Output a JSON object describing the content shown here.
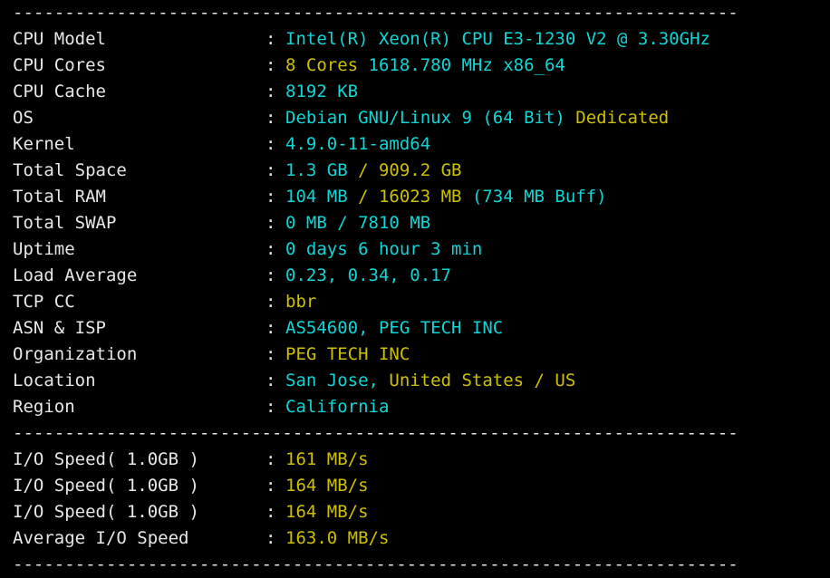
{
  "terminal": {
    "background": "#000000",
    "divider_char": "-",
    "divider_color": "#e6e6e6",
    "colon": ":",
    "colors": {
      "cyan": "#0fd5d5",
      "yellow": "#cdc000",
      "white": "#e8e8e8"
    },
    "divider_top": "----------------------------------------------------------------------",
    "divider_middle": "----------------------------------------------------------------------",
    "divider_bottom": "----------------------------------------------------------------------"
  },
  "system_info": {
    "rows": [
      {
        "label": "CPU Model",
        "segments": [
          {
            "text": "Intel(R) Xeon(R) CPU E3-1230 V2 @ 3.30GHz",
            "color": "cyan"
          }
        ]
      },
      {
        "label": "CPU Cores",
        "segments": [
          {
            "text": "8 Cores",
            "color": "yellow"
          },
          {
            "text": " 1618.780 MHz x86_64",
            "color": "cyan"
          }
        ]
      },
      {
        "label": "CPU Cache",
        "segments": [
          {
            "text": "8192 KB",
            "color": "cyan"
          }
        ]
      },
      {
        "label": "OS",
        "segments": [
          {
            "text": "Debian GNU/Linux 9 (64 Bit) ",
            "color": "cyan"
          },
          {
            "text": "Dedicated",
            "color": "yellow"
          }
        ]
      },
      {
        "label": "Kernel",
        "segments": [
          {
            "text": "4.9.0-11-amd64",
            "color": "cyan"
          }
        ]
      },
      {
        "label": "Total Space",
        "segments": [
          {
            "text": "1.3 GB ",
            "color": "cyan"
          },
          {
            "text": "/ 909.2 GB",
            "color": "yellow"
          }
        ]
      },
      {
        "label": "Total RAM",
        "segments": [
          {
            "text": "104 MB ",
            "color": "cyan"
          },
          {
            "text": "/ 16023 MB",
            "color": "yellow"
          },
          {
            "text": " (734 MB Buff)",
            "color": "cyan"
          }
        ]
      },
      {
        "label": "Total SWAP",
        "segments": [
          {
            "text": "0 MB / 7810 MB",
            "color": "cyan"
          }
        ]
      },
      {
        "label": "Uptime",
        "segments": [
          {
            "text": "0 days 6 hour 3 min",
            "color": "cyan"
          }
        ]
      },
      {
        "label": "Load Average",
        "segments": [
          {
            "text": "0.23, 0.34, 0.17",
            "color": "cyan"
          }
        ]
      },
      {
        "label": "TCP CC",
        "segments": [
          {
            "text": "bbr",
            "color": "yellow"
          }
        ]
      },
      {
        "label": "ASN & ISP",
        "segments": [
          {
            "text": "AS54600, PEG TECH INC",
            "color": "cyan"
          }
        ]
      },
      {
        "label": "Organization",
        "segments": [
          {
            "text": "PEG TECH INC",
            "color": "yellow"
          }
        ]
      },
      {
        "label": "Location",
        "segments": [
          {
            "text": "San Jose, ",
            "color": "cyan"
          },
          {
            "text": "United States / US",
            "color": "yellow"
          }
        ]
      },
      {
        "label": "Region",
        "segments": [
          {
            "text": "California",
            "color": "cyan"
          }
        ]
      }
    ]
  },
  "io_benchmark": {
    "rows": [
      {
        "label": "I/O Speed( 1.0GB )",
        "segments": [
          {
            "text": "161 MB/s",
            "color": "yellow"
          }
        ]
      },
      {
        "label": "I/O Speed( 1.0GB )",
        "segments": [
          {
            "text": "164 MB/s",
            "color": "yellow"
          }
        ]
      },
      {
        "label": "I/O Speed( 1.0GB )",
        "segments": [
          {
            "text": "164 MB/s",
            "color": "yellow"
          }
        ]
      },
      {
        "label": "Average I/O Speed",
        "segments": [
          {
            "text": "163.0 MB/s",
            "color": "yellow"
          }
        ]
      }
    ]
  }
}
